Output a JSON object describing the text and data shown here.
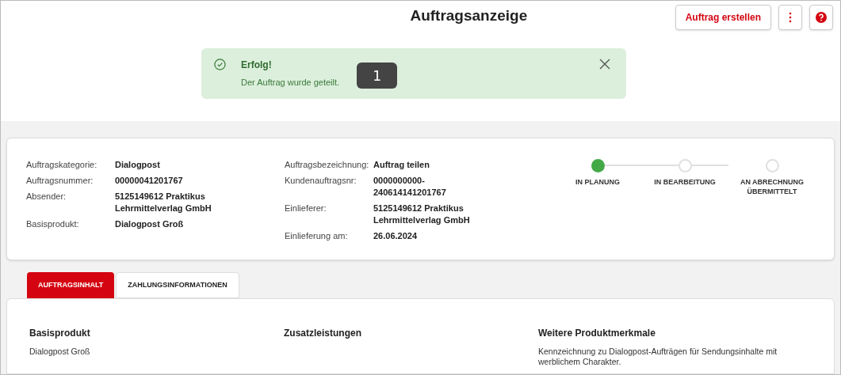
{
  "header": {
    "title": "Auftragsanzeige",
    "buttons": [
      {
        "kind": "text",
        "label": "Auftrag erstellen"
      },
      {
        "kind": "more"
      },
      {
        "kind": "help"
      }
    ]
  },
  "alert": {
    "title": "Erfolg!",
    "message": "Der Auftrag wurde geteilt.",
    "marker": "1"
  },
  "details": {
    "left": [
      {
        "label": "Auftragskategorie:",
        "value": "Dialogpost"
      },
      {
        "label": "Auftragsnummer:",
        "value": "00000041201767"
      },
      {
        "label": "Absender:",
        "value": "5125149612 Praktikus Lehrmittelverlag GmbH"
      },
      {
        "label": "Basisprodukt:",
        "value": "Dialogpost Groß"
      }
    ],
    "right": [
      {
        "label": "Auftragsbezeichnung:",
        "value": "Auftrag teilen"
      },
      {
        "label": "Kundenauftragsnr:",
        "value": "0000000000-240614141201767"
      },
      {
        "label": "Einlieferer:",
        "value": "5125149612 Praktikus Lehrmittelverlag GmbH"
      },
      {
        "label": "Einlieferung am:",
        "value": "26.06.2024"
      }
    ]
  },
  "status_steps": [
    {
      "label": "IN PLANUNG",
      "selected": true
    },
    {
      "label": "IN BEARBEITUNG",
      "selected": false
    },
    {
      "label": "AN ABRECHNUNG ÜBERMITTELT",
      "selected": false
    }
  ],
  "tabs": [
    {
      "label": "AUFTRAGSINHALT",
      "selected": true
    },
    {
      "label": "ZAHLUNGSINFORMATIONEN",
      "selected": false
    }
  ],
  "content": [
    {
      "heading": "Basisprodukt",
      "text": "Dialogpost Groß"
    },
    {
      "heading": "Zusatzleistungen"
    },
    {
      "heading": "Weitere Produktmerkmale",
      "text": "Kennzeichnung zu Dialogpost-Aufträgen für Sendungsinhalte mit werblichem Charakter."
    }
  ]
}
